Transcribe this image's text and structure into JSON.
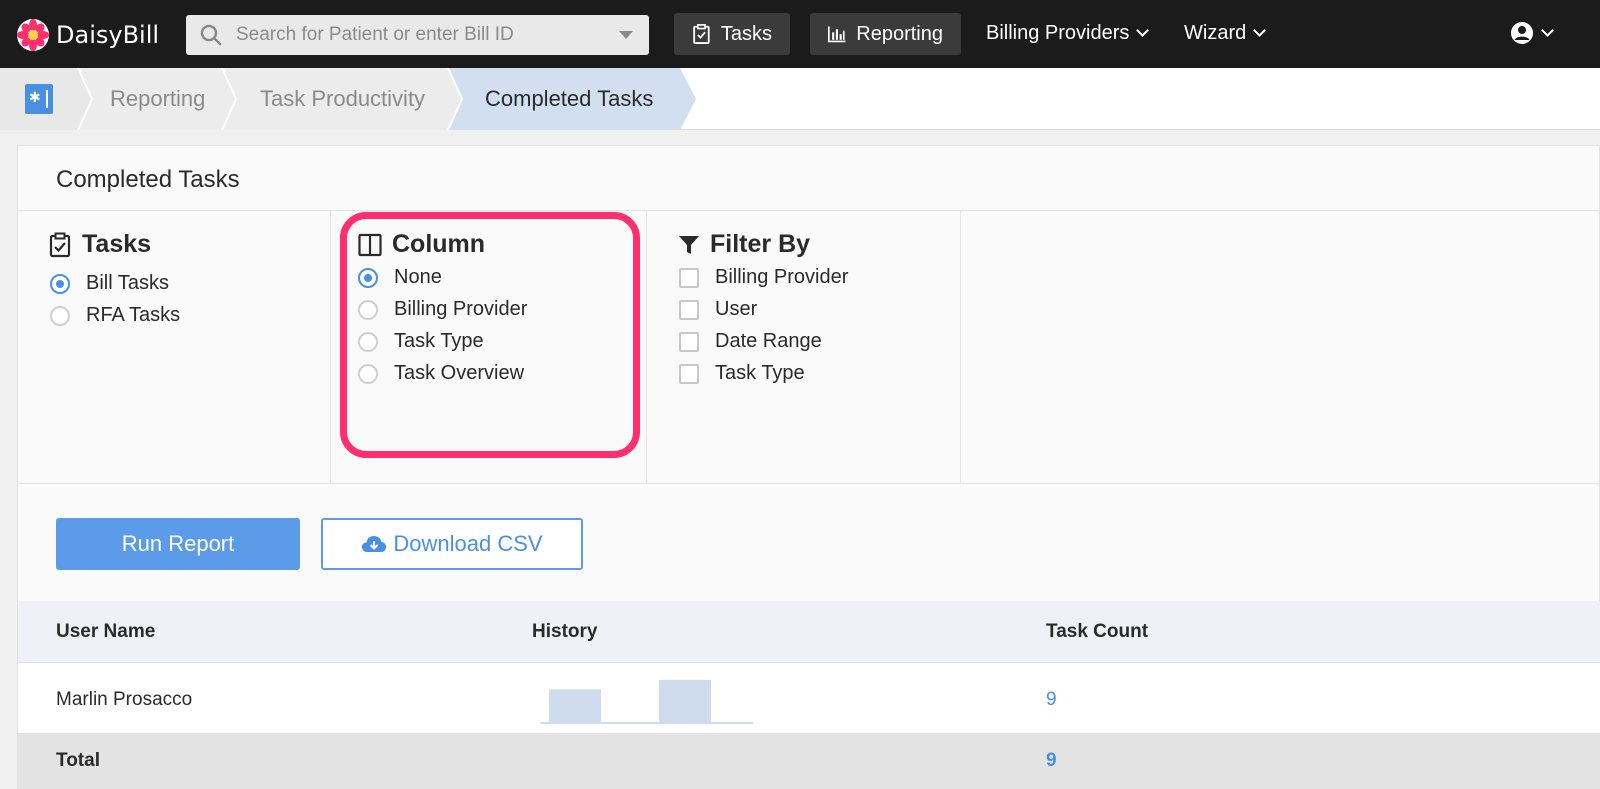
{
  "nav": {
    "brand": "DaisyBill",
    "search_placeholder": "Search for Patient or enter Bill ID",
    "tasks_label": "Tasks",
    "reporting_label": "Reporting",
    "billing_providers_label": "Billing Providers",
    "wizard_label": "Wizard"
  },
  "breadcrumb": {
    "items": [
      "Reporting",
      "Task Productivity",
      "Completed Tasks"
    ]
  },
  "panel": {
    "title": "Completed Tasks",
    "tasks": {
      "title": "Tasks",
      "options": [
        {
          "label": "Bill Tasks",
          "selected": true
        },
        {
          "label": "RFA Tasks",
          "selected": false
        }
      ]
    },
    "column": {
      "title": "Column",
      "options": [
        {
          "label": "None",
          "selected": true
        },
        {
          "label": "Billing Provider",
          "selected": false
        },
        {
          "label": "Task Type",
          "selected": false
        },
        {
          "label": "Task Overview",
          "selected": false
        }
      ]
    },
    "filter": {
      "title": "Filter By",
      "options": [
        {
          "label": "Billing Provider",
          "checked": false
        },
        {
          "label": "User",
          "checked": false
        },
        {
          "label": "Date Range",
          "checked": false
        },
        {
          "label": "Task Type",
          "checked": false
        }
      ]
    },
    "run_report_label": "Run Report",
    "download_csv_label": "Download CSV"
  },
  "table": {
    "headers": [
      "User Name",
      "History",
      "Task Count"
    ],
    "rows": [
      {
        "user": "Marlin Prosacco",
        "history": [
          0.7,
          0,
          0.9,
          0
        ],
        "count": "9"
      }
    ],
    "total_label": "Total",
    "total_count": "9"
  },
  "colors": {
    "accent": "#4a90e2",
    "highlight": "#ff2e6e",
    "nav_bg": "#1b1b1b"
  }
}
